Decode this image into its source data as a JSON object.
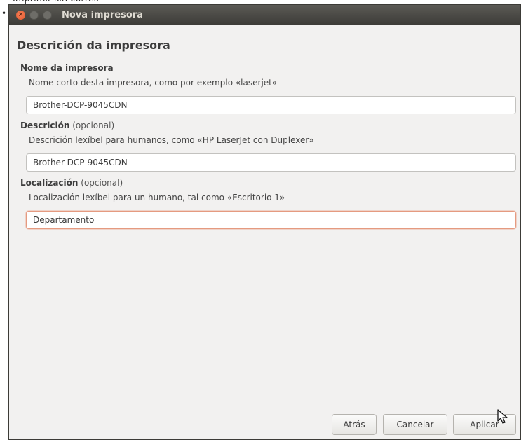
{
  "window": {
    "title": "Nova impresora"
  },
  "page": {
    "heading": "Descrición da impresora"
  },
  "fields": {
    "name": {
      "label": "Nome da impresora",
      "optional": "",
      "hint": "Nome corto desta impresora, como por exemplo «laserjet»",
      "value": "Brother-DCP-9045CDN"
    },
    "description": {
      "label": "Descrición",
      "optional": "(opcional)",
      "hint": "Descrición lexíbel para humanos, como «HP LaserJet con Duplexer»",
      "value": "Brother DCP-9045CDN"
    },
    "location": {
      "label": "Localización",
      "optional": "(opcional)",
      "hint": "Localización lexíbel para un humano, tal como «Escritorio 1»",
      "value": "Departamento"
    }
  },
  "buttons": {
    "back": "Atrás",
    "cancel": "Cancelar",
    "apply": "Aplicar"
  },
  "colors": {
    "close_button": "#e2562a",
    "focus_border": "#e59a80",
    "titlebar": "#3d3c38"
  },
  "icons": {
    "close": "close-icon",
    "minimize": "minimize-icon",
    "maximize": "maximize-icon",
    "pointer": "mouse-pointer-icon"
  }
}
